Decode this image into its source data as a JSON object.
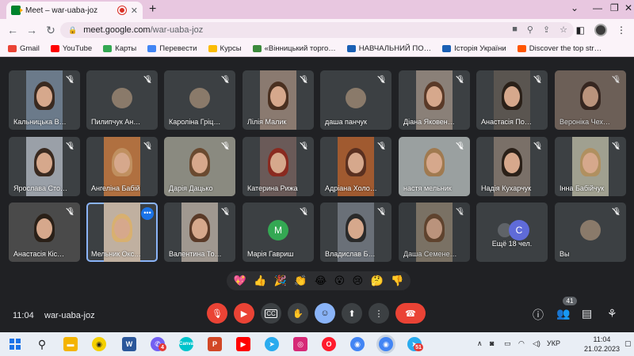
{
  "browser": {
    "tab_title": "Meet – war-uaba-joz",
    "new_tab": "+",
    "url_host": "meet.google.com",
    "url_path": "/war-uaba-joz",
    "bookmarks": [
      {
        "label": "Gmail",
        "color": "#ea4335"
      },
      {
        "label": "YouTube",
        "color": "#ff0000"
      },
      {
        "label": "Карты",
        "color": "#34a853"
      },
      {
        "label": "Перевести",
        "color": "#4285f4"
      },
      {
        "label": "Курсы",
        "color": "#fbbc04"
      },
      {
        "label": "«Вінницький торго…",
        "color": "#3c8a3c"
      },
      {
        "label": "НАВЧАЛЬНИЙ ПО…",
        "color": "#1a5fb4"
      },
      {
        "label": "Історія України",
        "color": "#1a5fb4"
      },
      {
        "label": "Discover the top str…",
        "color": "#ff5500"
      }
    ]
  },
  "participants": [
    {
      "name": "Кальницька В…",
      "kind": "video",
      "bg": "#6b7a8a",
      "hair": "#3a2a20"
    },
    {
      "name": "Пилипчук Ан…",
      "kind": "avatar-photo",
      "bg": "#3c4043"
    },
    {
      "name": "Кароліна Гріц…",
      "kind": "avatar-photo",
      "bg": "#3c4043"
    },
    {
      "name": "Лілія Малик",
      "kind": "video",
      "bg": "#8a7a70",
      "hair": "#4a3020"
    },
    {
      "name": "даша панчук",
      "kind": "avatar-photo",
      "bg": "#3c4043"
    },
    {
      "name": "Діана Яковен…",
      "kind": "video",
      "bg": "#8a8078",
      "hair": "#5a3a28"
    },
    {
      "name": "Анастасія По…",
      "kind": "video",
      "bg": "#5a5550",
      "hair": "#2a2018"
    },
    {
      "name": "Вероніка Чех…",
      "kind": "video-dim",
      "bg": "#7a6a60",
      "hair": "#3a2820"
    },
    {
      "name": "Ярослава Сто…",
      "kind": "video",
      "bg": "#9aa0a8",
      "hair": "#3a2a20"
    },
    {
      "name": "Ангеліна Бабій",
      "kind": "video",
      "bg": "#b07040",
      "hair": "#c09060"
    },
    {
      "name": "Дарія Дацько",
      "kind": "video",
      "bg": "#8a8a80",
      "hair": "#6a4a30"
    },
    {
      "name": "Катерина Рижа",
      "kind": "video",
      "bg": "#6a5a58",
      "hair": "#8a2a20"
    },
    {
      "name": "Адріана Холо…",
      "kind": "video",
      "bg": "#a05a30",
      "hair": "#5a3020"
    },
    {
      "name": "настя мельник",
      "kind": "video",
      "bg": "#9aa0a0",
      "hair": "#a07a50"
    },
    {
      "name": "Надія Кухарчук",
      "kind": "video",
      "bg": "#7a7068",
      "hair": "#2a2018"
    },
    {
      "name": "Інна Бабійчук",
      "kind": "video",
      "bg": "#a0a090",
      "hair": "#b09060"
    },
    {
      "name": "Анастасія Кіс…",
      "kind": "video",
      "bg": "#4a4a4a",
      "hair": "#2a2018"
    },
    {
      "name": "Мельник Окс…",
      "kind": "video-speaking",
      "bg": "#c0b0a0",
      "hair": "#d8b070"
    },
    {
      "name": "Валентина То…",
      "kind": "video",
      "bg": "#a09890",
      "hair": "#5a3a28"
    },
    {
      "name": "Марія Гавриш",
      "kind": "letter",
      "letter": "M",
      "color": "#34a853"
    },
    {
      "name": "Владислав Б…",
      "kind": "video",
      "bg": "#6a7078",
      "hair": "#2a2a2a"
    },
    {
      "name": "Даша Семене…",
      "kind": "video-dim",
      "bg": "#8a8070",
      "hair": "#6a4a30"
    },
    {
      "name": "Ещё 18 чел.",
      "kind": "more",
      "letter": "C",
      "color": "#5f6bd8"
    },
    {
      "name": "Вы",
      "kind": "avatar-photo",
      "bg": "#3c4043"
    }
  ],
  "reactions": [
    "💖",
    "👍",
    "🎉",
    "👏",
    "😂",
    "😮",
    "😢",
    "🤔",
    "👎"
  ],
  "bottom": {
    "time": "11:04",
    "code": "war-uaba-joz",
    "people_count": "41"
  },
  "taskbar": {
    "lang": "УКР",
    "time": "11:04",
    "date": "21.02.2023",
    "viber_badge": "4",
    "telegram_badge": "51"
  }
}
